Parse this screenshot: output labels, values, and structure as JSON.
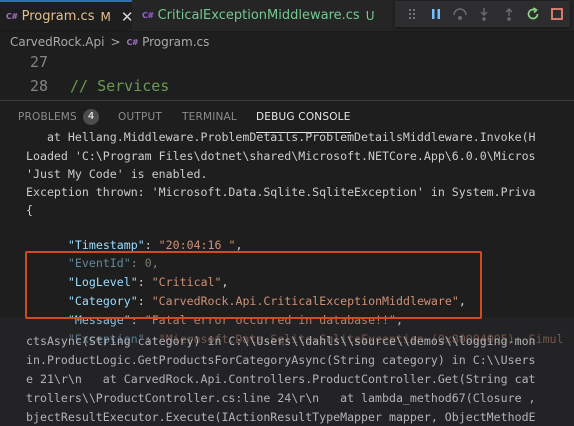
{
  "tabs": [
    {
      "badge": "C#",
      "label": "Program.cs",
      "status": "M"
    },
    {
      "badge": "C#",
      "label": "CriticalExceptionMiddleware.cs",
      "status": "U"
    }
  ],
  "debug_toolbar": [
    "pause-icon",
    "step-over-icon",
    "step-into-icon",
    "step-out-icon",
    "restart-icon",
    "stop-icon"
  ],
  "breadcrumb": {
    "project": "CarvedRock.Api",
    "sep": ">",
    "file_badge": "C#",
    "file": "Program.cs"
  },
  "editor": {
    "lines": [
      {
        "num": "27",
        "text": ""
      },
      {
        "num": "28",
        "text": "// Services"
      }
    ]
  },
  "panel": {
    "tabs": [
      {
        "label": "PROBLEMS",
        "count": "4"
      },
      {
        "label": "OUTPUT"
      },
      {
        "label": "TERMINAL"
      },
      {
        "label": "DEBUG CONSOLE"
      }
    ]
  },
  "console": {
    "lines": [
      "   at Hellang.Middleware.ProblemDetails.ProblemDetailsMiddleware.Invoke(H",
      "Loaded 'C:\\Program Files\\dotnet\\shared\\Microsoft.NETCore.App\\6.0.0\\Micros",
      "'Just My Code' is enabled.",
      "Exception thrown: 'Microsoft.Data.Sqlite.SqliteException' in System.Priva",
      "{"
    ],
    "json_fields": [
      {
        "key": "\"Timestamp\"",
        "value": "\"20:04:16 \"",
        "type": "string"
      },
      {
        "key": "\"EventId\"",
        "value": "0",
        "type": "number"
      },
      {
        "key": "\"LogLevel\"",
        "value": "\"Critical\"",
        "type": "string"
      },
      {
        "key": "\"Category\"",
        "value": "\"CarvedRock.Api.CriticalExceptionMiddleware\"",
        "type": "string"
      },
      {
        "key": "\"Message\"",
        "value": "\"Fatal error occurred in database!!\"",
        "type": "string"
      },
      {
        "key": "\"Exception\"",
        "value": "\"Microsoft.Data.Sqlite.SqliteException (0x80004005): Simul",
        "type": "string"
      }
    ],
    "trace_lines": [
      "ctsAsync(String category) in C:\\\\Users\\\\dahls\\\\source\\\\demos\\\\logging-mon",
      "in.ProductLogic.GetProductsForCategoryAsync(String category) in C:\\\\Users",
      "e 21\\r\\n   at CarvedRock.Api.Controllers.ProductController.Get(String cat",
      "trollers\\\\ProductController.cs:line 24\\r\\n   at lambda_method67(Closure ,",
      "bjectResultExecutor.Execute(IActionResultTypeMapper mapper, ObjectMethodE"
    ]
  },
  "colors": {
    "accent": "#2f6fb5",
    "highlight_box": "#d04a22",
    "modified": "#e2c08d",
    "untracked": "#73c991"
  }
}
